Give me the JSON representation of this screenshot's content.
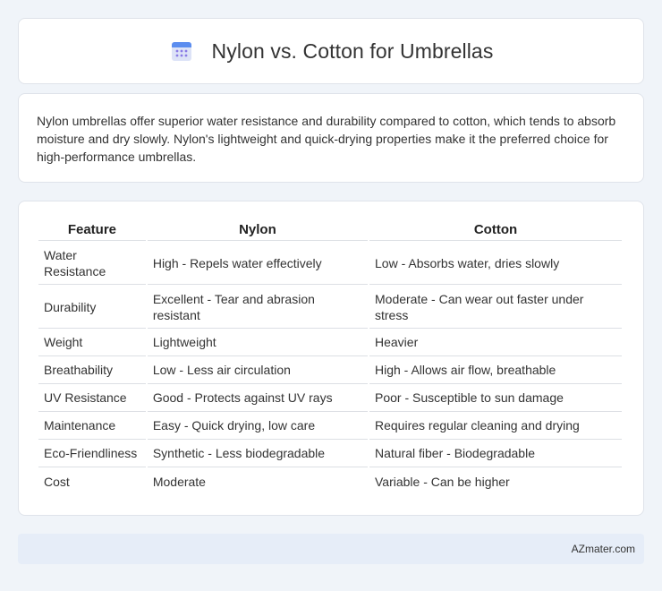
{
  "header": {
    "title": "Nylon vs. Cotton for Umbrellas",
    "icon": "calendar-icon"
  },
  "intro": {
    "text": "Nylon umbrellas offer superior water resistance and durability compared to cotton, which tends to absorb moisture and dry slowly. Nylon's lightweight and quick-drying properties make it the preferred choice for high-performance umbrellas."
  },
  "table": {
    "headers": [
      "Feature",
      "Nylon",
      "Cotton"
    ],
    "rows": [
      [
        "Water Resistance",
        "High - Repels water effectively",
        "Low - Absorbs water, dries slowly"
      ],
      [
        "Durability",
        "Excellent - Tear and abrasion resistant",
        "Moderate - Can wear out faster under stress"
      ],
      [
        "Weight",
        "Lightweight",
        "Heavier"
      ],
      [
        "Breathability",
        "Low - Less air circulation",
        "High - Allows air flow, breathable"
      ],
      [
        "UV Resistance",
        "Good - Protects against UV rays",
        "Poor - Susceptible to sun damage"
      ],
      [
        "Maintenance",
        "Easy - Quick drying, low care",
        "Requires regular cleaning and drying"
      ],
      [
        "Eco-Friendliness",
        "Synthetic - Less biodegradable",
        "Natural fiber - Biodegradable"
      ],
      [
        "Cost",
        "Moderate",
        "Variable - Can be higher"
      ]
    ]
  },
  "footer": {
    "text": "AZmater.com"
  },
  "colors": {
    "background": "#f0f4f9",
    "card": "#ffffff",
    "footer_bg": "#e6edf8",
    "icon_blue": "#5b8def",
    "icon_purple": "#8a7be6"
  }
}
